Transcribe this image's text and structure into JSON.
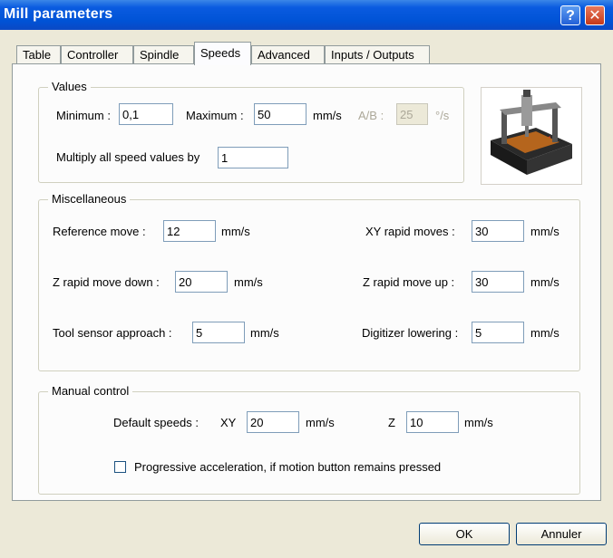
{
  "window": {
    "title": "Mill parameters",
    "help_glyph": "?",
    "close_glyph": "✕"
  },
  "tabs": [
    {
      "label": "Table"
    },
    {
      "label": "Controller"
    },
    {
      "label": "Spindle"
    },
    {
      "label": "Speeds",
      "active": true
    },
    {
      "label": "Advanced"
    },
    {
      "label": "Inputs / Outputs"
    }
  ],
  "values": {
    "legend": "Values",
    "minimum_label": "Minimum :",
    "minimum_value": "0,1",
    "maximum_label": "Maximum :",
    "maximum_value": "50",
    "unit": "mm/s",
    "ab_label": "A/B :",
    "ab_value": "25",
    "ab_unit": "°/s",
    "multiply_label": "Multiply all speed values by",
    "multiply_value": "1"
  },
  "misc": {
    "legend": "Miscellaneous",
    "reference_move_label": "Reference move :",
    "reference_move_value": "12",
    "xy_rapid_label": "XY rapid moves :",
    "xy_rapid_value": "30",
    "z_down_label": "Z rapid move down :",
    "z_down_value": "20",
    "z_up_label": "Z rapid move up :",
    "z_up_value": "30",
    "tool_sensor_label": "Tool sensor approach :",
    "tool_sensor_value": "5",
    "digitizer_label": "Digitizer lowering :",
    "digitizer_value": "5",
    "unit": "mm/s"
  },
  "manual": {
    "legend": "Manual control",
    "default_speeds_label": "Default speeds :",
    "xy_label": "XY",
    "xy_value": "20",
    "z_label": "Z",
    "z_value": "10",
    "unit": "mm/s",
    "progressive_label": "Progressive acceleration, if motion button remains pressed",
    "progressive_checked": false
  },
  "buttons": {
    "ok": "OK",
    "cancel": "Annuler"
  },
  "colors": {
    "titlebar": "#0053d6",
    "window_bg": "#ece9d8",
    "panel_bg": "#fcfcfc"
  }
}
